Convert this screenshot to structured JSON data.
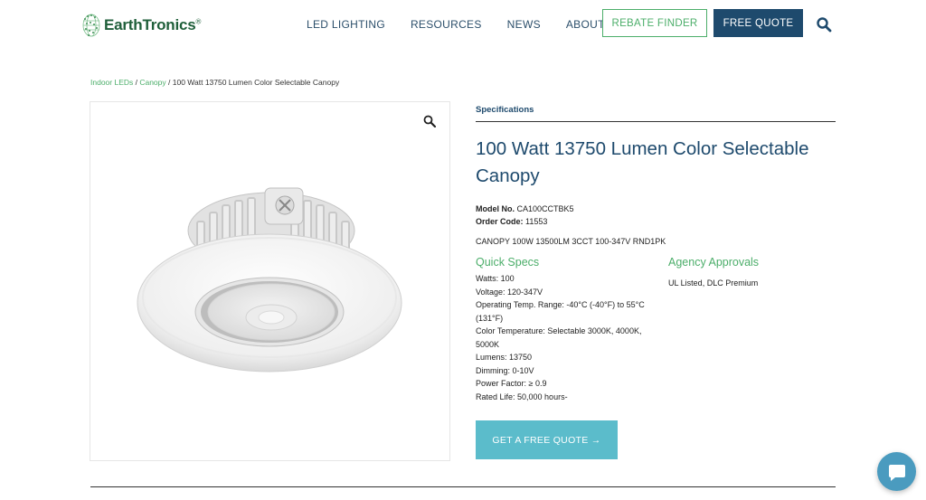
{
  "header": {
    "logo_text": "EarthTronics",
    "logo_mark": "®",
    "nav": [
      "LED LIGHTING",
      "RESOURCES",
      "NEWS",
      "ABOUT"
    ],
    "rebate_label": "REBATE FINDER",
    "quote_label": "FREE QUOTE",
    "search_icon": "search-icon"
  },
  "breadcrumb": {
    "crumb1": "Indoor LEDs",
    "sep1": " / ",
    "crumb2": "Canopy",
    "sep2": " / ",
    "current": "100 Watt 13750 Lumen Color Selectable Canopy"
  },
  "product": {
    "tab": "Specifications",
    "title": "100 Watt 13750 Lumen Color Selectable Canopy",
    "model_label": "Model No.",
    "model_value": "CA100CCTBK5",
    "order_label": "Order Code:",
    "order_value": "11553",
    "description": "CANOPY 100W 13500LM 3CCT 100-347V RND1PK",
    "quick_specs_heading": "Quick Specs",
    "quick_specs": [
      "Watts: 100",
      "Voltage: 120-347V",
      "Operating Temp. Range: -40°C (-40°F) to 55°C (131°F)",
      "Color Temperature: Selectable 3000K, 4000K, 5000K",
      "Lumens: 13750",
      "Dimming: 0-10V",
      "Power Factor: ≥ 0.9",
      "Rated Life: 50,000 hours-"
    ],
    "agency_heading": "Agency Approvals",
    "agency_text": "UL Listed, DLC Premium",
    "cta_label": "GET A FREE QUOTE →"
  },
  "colors": {
    "brand_navy": "#1e4a6d",
    "brand_green": "#4cae6a",
    "cta_teal": "#5bbccb",
    "chat_blue": "#4a9bbf"
  },
  "icons": [
    "search-icon",
    "zoom-icon",
    "chat-icon",
    "logo-globe-icon"
  ]
}
